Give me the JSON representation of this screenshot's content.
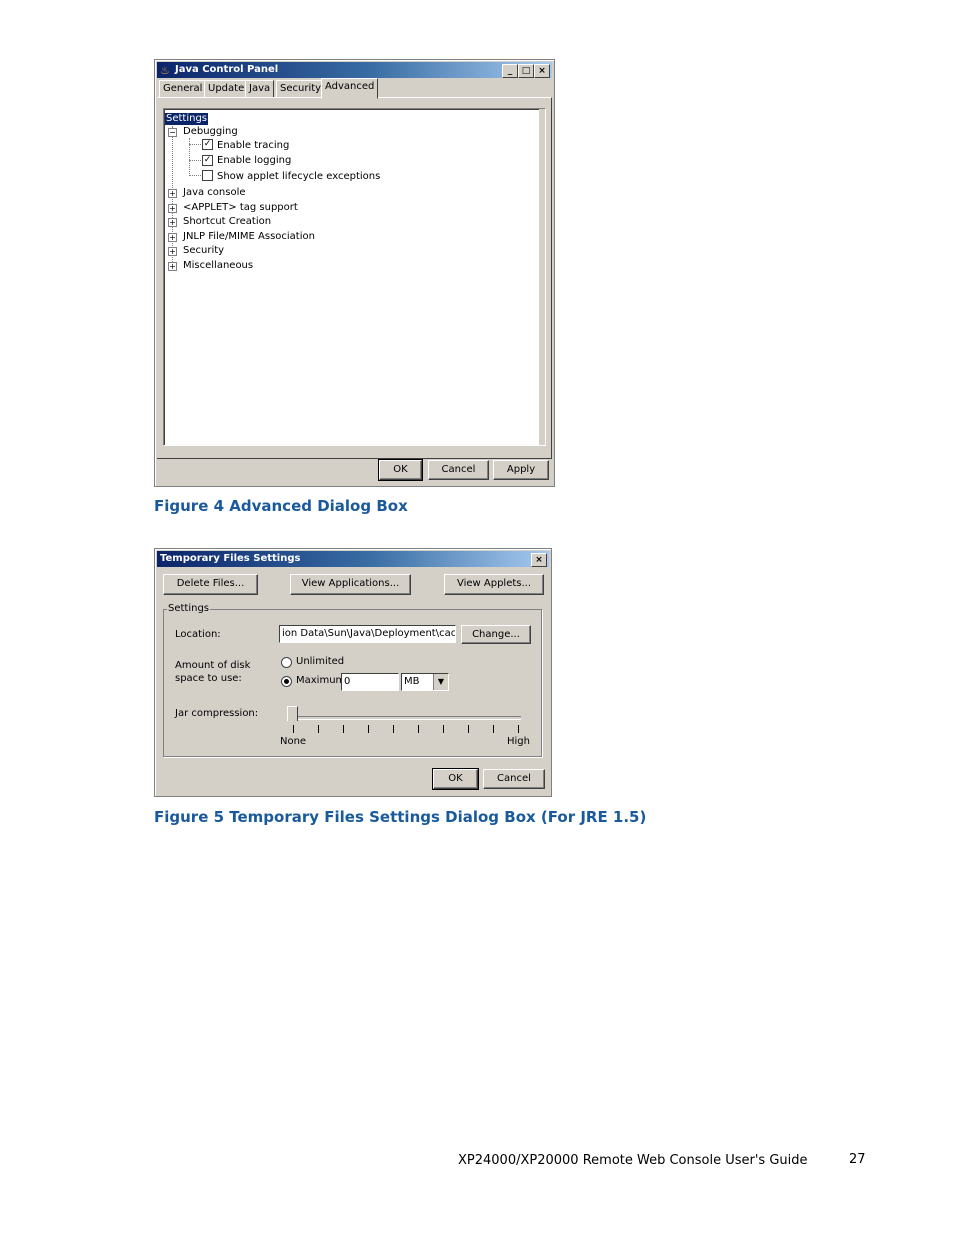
{
  "figure4": {
    "title": "Java Control Panel",
    "tabs": [
      "General",
      "Update",
      "Java",
      "Security",
      "Advanced"
    ],
    "active_tab": "Advanced",
    "tree": {
      "root": "Settings",
      "debugging": "Debugging",
      "enable_tracing": "Enable tracing",
      "enable_logging": "Enable logging",
      "show_applet": "Show applet lifecycle exceptions",
      "java_console": "Java console",
      "applet_tag": "<APPLET> tag support",
      "shortcut": "Shortcut Creation",
      "jnlp": "JNLP File/MIME Association",
      "security": "Security",
      "misc": "Miscellaneous"
    },
    "buttons": {
      "ok": "OK",
      "cancel": "Cancel",
      "apply": "Apply"
    },
    "caption": "Figure 4 Advanced Dialog Box"
  },
  "figure5": {
    "title": "Temporary Files Settings",
    "buttons": {
      "delete": "Delete Files...",
      "view_apps": "View Applications...",
      "view_applets": "View Applets...",
      "change": "Change...",
      "ok": "OK",
      "cancel": "Cancel"
    },
    "group": "Settings",
    "location_label": "Location:",
    "location_value": "ion Data\\Sun\\Java\\Deployment\\cache",
    "amount_label_1": "Amount of disk",
    "amount_label_2": "space to use:",
    "unlimited": "Unlimited",
    "maximum": "Maximum",
    "max_value": "0",
    "unit": "MB",
    "jar_label": "Jar compression:",
    "slider_none": "None",
    "slider_high": "High",
    "caption": "Figure 5 Temporary Files Settings Dialog Box (For JRE 1.5)"
  },
  "footer": {
    "guide": "XP24000/XP20000 Remote Web Console User's Guide",
    "page": "27"
  }
}
